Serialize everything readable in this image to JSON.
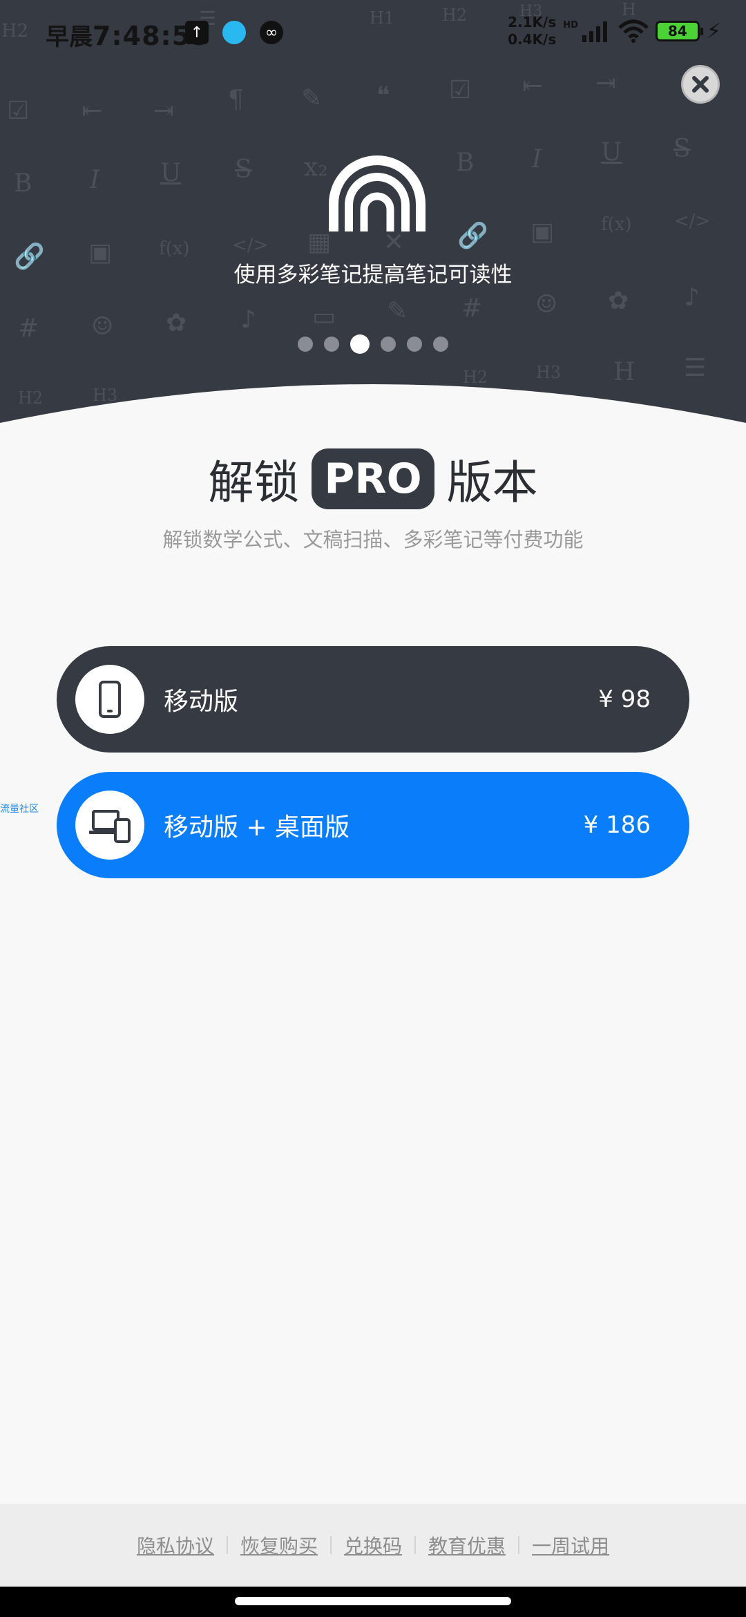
{
  "status_bar": {
    "period": "早晨",
    "time": "7:48:55",
    "speed_up": "2.1K/s",
    "speed_down": "0.4K/s",
    "net_label": "HD",
    "battery": "84"
  },
  "hero": {
    "caption": "使用多彩笔记提高笔记可读性",
    "pages": 6,
    "active_page": 3
  },
  "title": {
    "prefix": "解锁",
    "badge": "PRO",
    "suffix": "版本"
  },
  "subtitle": "解锁数学公式、文稿扫描、多彩笔记等付费功能",
  "plans": [
    {
      "name": "移动版",
      "price": "¥ 98",
      "icon": "phone-icon"
    },
    {
      "name": "移动版 + 桌面版",
      "price": "¥ 186",
      "icon": "devices-icon"
    }
  ],
  "side_link": "流量社区",
  "footer": {
    "links": [
      "隐私协议",
      "恢复购买",
      "兑换码",
      "教育优惠",
      "一周试用"
    ]
  },
  "colors": {
    "dark": "#363a42",
    "accent": "#0a7dfa"
  }
}
